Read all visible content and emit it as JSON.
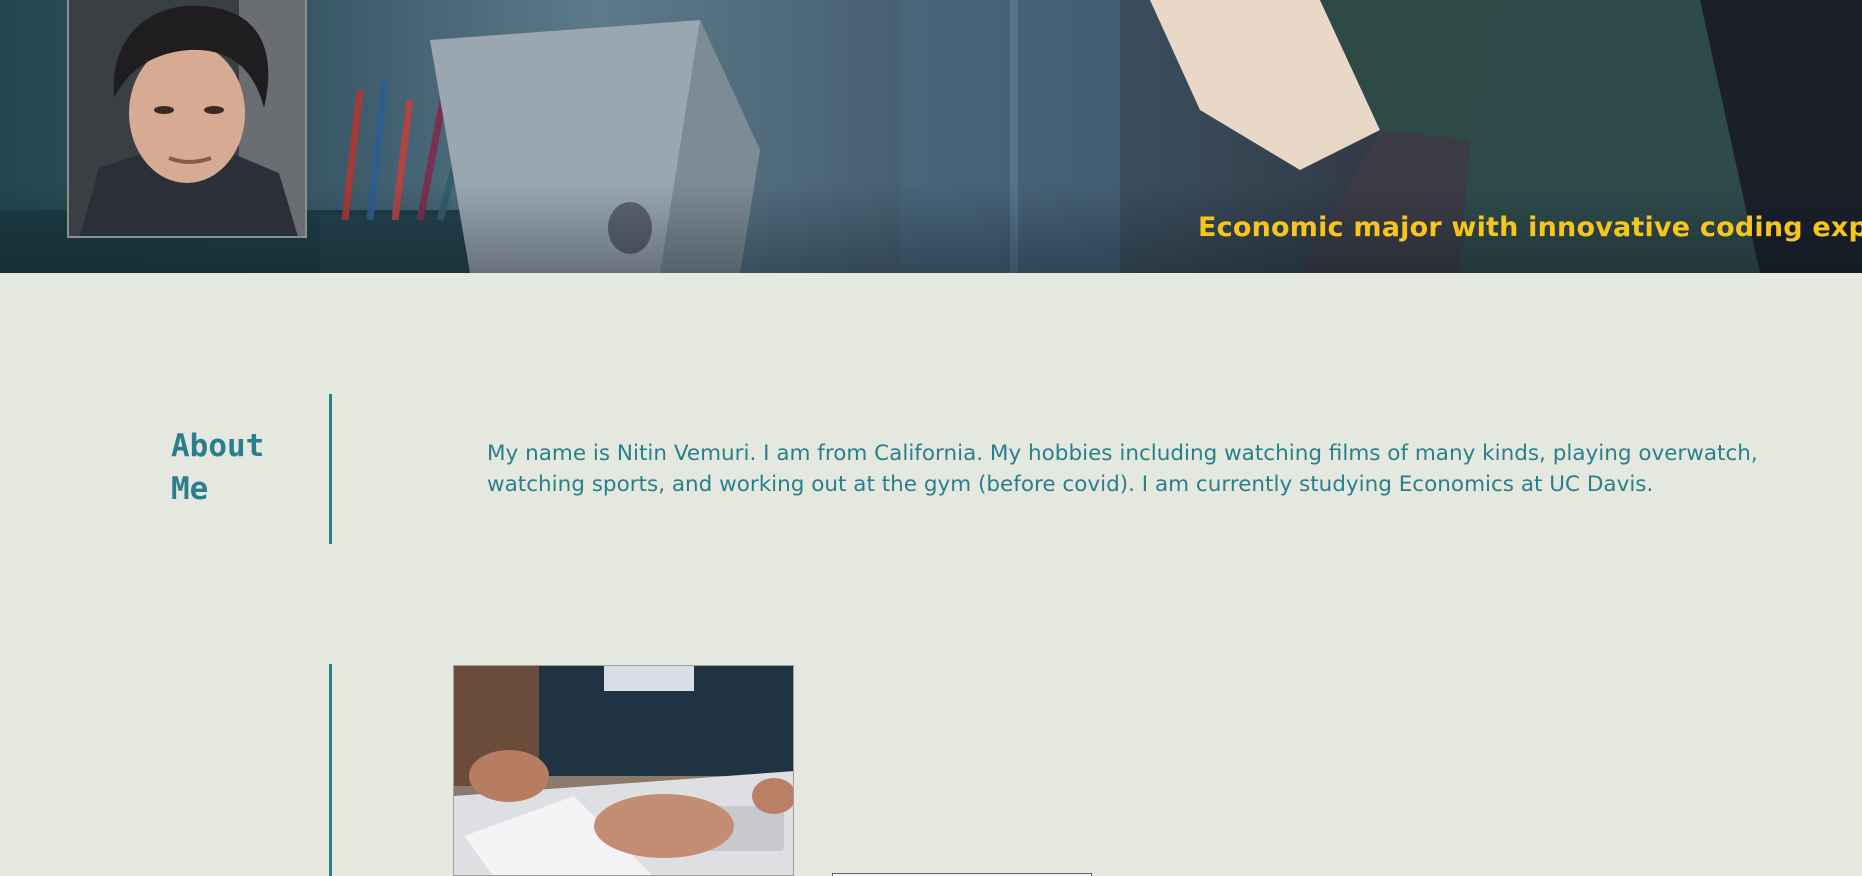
{
  "hero": {
    "tagline": "Economic major with innovative coding experienc"
  },
  "about": {
    "heading": "About Me",
    "paragraph": "My name is Nitin Vemuri. I am from California. My hobbies including watching films of many kinds, playing overwatch, watching sports, and working out at the gym (before covid). I am currently studying Economics at UC Davis."
  },
  "colors": {
    "accent": "#2a7f8d",
    "tagline": "#f6c61e",
    "page_background": "#e4e8df"
  }
}
